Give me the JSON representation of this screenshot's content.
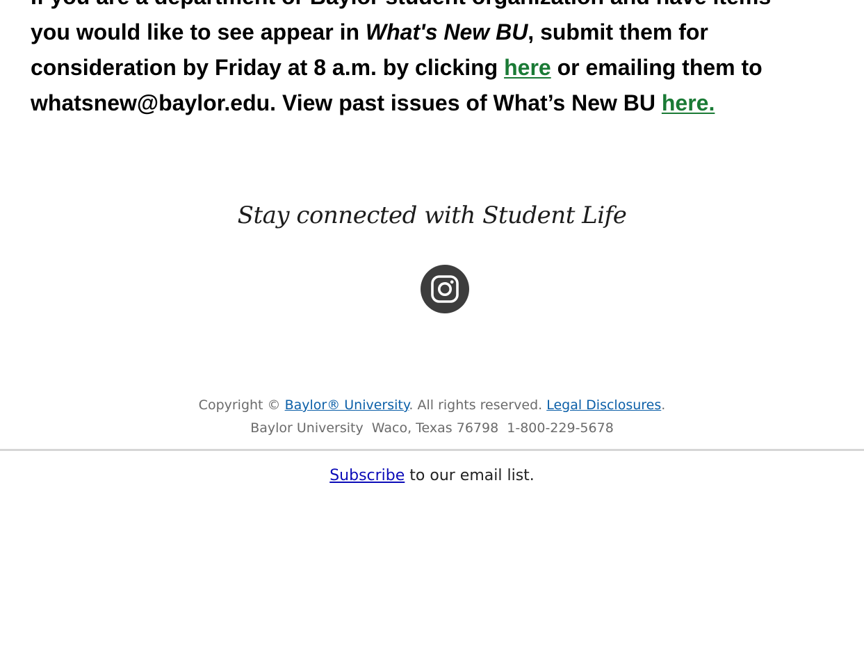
{
  "intro": {
    "line1": "If you are a department or Baylor student organization and have items",
    "text_before_em": "you would like to see appear in ",
    "em": "What's New BU",
    "text_after_em": ", submit them for consideration by Friday at 8 a.m. by clicking ",
    "link1": "here",
    "text_mid": " or emailing them to whatsnew@baylor.edu. View past issues of What’s New BU ",
    "link2": "here."
  },
  "social": {
    "heading": "Stay connected with Student Life",
    "icons": [
      "instagram-icon"
    ]
  },
  "footer": {
    "copyright_prefix": "Copyright © ",
    "baylor_link": "Baylor® University",
    "rights_text": ". All rights reserved. ",
    "legal_link": "Legal Disclosures",
    "legal_suffix": ".",
    "address": "Baylor University  Waco, Texas 76798  1-800-229-5678"
  },
  "subscribe": {
    "link": "Subscribe",
    "text": " to our email list."
  },
  "colors": {
    "link_green": "#1a7a35",
    "link_blue": "#0b5fa8",
    "subscribe_blue": "#0b0bb8",
    "icon_bg": "#3d3d3d",
    "divider": "#d6d6d6"
  }
}
